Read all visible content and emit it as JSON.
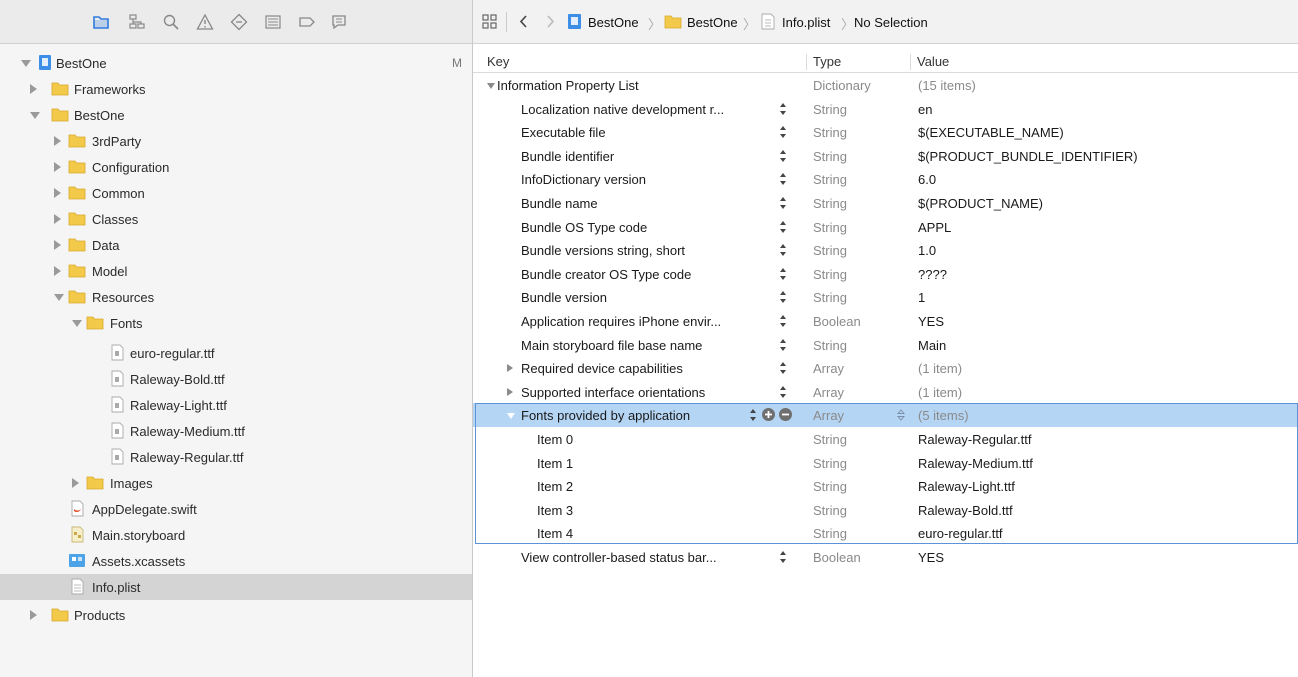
{
  "navigator": {
    "toolbar_icons": [
      "folder-icon",
      "hierarchy-icon",
      "search-icon",
      "warning-icon",
      "test-diamond-icon",
      "debug-icon",
      "breakpoint-icon",
      "report-icon"
    ],
    "badge": "M",
    "tree": [
      {
        "label": "BestOne",
        "icon": "project-icon",
        "state": "open"
      },
      {
        "label": "Frameworks",
        "icon": "folder-icon",
        "state": "closed"
      },
      {
        "label": "BestOne",
        "icon": "folder-icon",
        "state": "open"
      },
      {
        "label": "3rdParty",
        "icon": "folder-icon",
        "state": "closed"
      },
      {
        "label": "Configuration",
        "icon": "folder-icon",
        "state": "closed"
      },
      {
        "label": "Common",
        "icon": "folder-icon",
        "state": "closed"
      },
      {
        "label": "Classes",
        "icon": "folder-icon",
        "state": "closed"
      },
      {
        "label": "Data",
        "icon": "folder-icon",
        "state": "closed"
      },
      {
        "label": "Model",
        "icon": "folder-icon",
        "state": "closed"
      },
      {
        "label": "Resources",
        "icon": "folder-icon",
        "state": "open"
      },
      {
        "label": "Fonts",
        "icon": "folder-icon",
        "state": "open"
      },
      {
        "label": "euro-regular.ttf",
        "icon": "file-icon"
      },
      {
        "label": "Raleway-Bold.ttf",
        "icon": "file-icon"
      },
      {
        "label": "Raleway-Light.ttf",
        "icon": "file-icon"
      },
      {
        "label": "Raleway-Medium.ttf",
        "icon": "file-icon"
      },
      {
        "label": "Raleway-Regular.ttf",
        "icon": "file-icon"
      },
      {
        "label": "Images",
        "icon": "folder-icon",
        "state": "closed"
      },
      {
        "label": "AppDelegate.swift",
        "icon": "swift-file-icon"
      },
      {
        "label": "Main.storyboard",
        "icon": "storyboard-icon"
      },
      {
        "label": "Assets.xcassets",
        "icon": "assets-icon"
      },
      {
        "label": "Info.plist",
        "icon": "plist-file-icon",
        "selected": true
      },
      {
        "label": "Products",
        "icon": "folder-icon",
        "state": "closed"
      }
    ]
  },
  "jumpbar": {
    "crumbs": [
      "BestOne",
      "BestOne",
      "Info.plist",
      "No Selection"
    ]
  },
  "plist": {
    "headers": {
      "key": "Key",
      "type": "Type",
      "value": "Value"
    },
    "rows": [
      {
        "key": "Information Property List",
        "type": "Dictionary",
        "value": "(15 items)",
        "triangle": "open",
        "value_gray": true
      },
      {
        "key": "Localization native development r...",
        "type": "String",
        "value": "en",
        "stepper": true
      },
      {
        "key": "Executable file",
        "type": "String",
        "value": "$(EXECUTABLE_NAME)",
        "stepper": true
      },
      {
        "key": "Bundle identifier",
        "type": "String",
        "value": "$(PRODUCT_BUNDLE_IDENTIFIER)",
        "stepper": true
      },
      {
        "key": "InfoDictionary version",
        "type": "String",
        "value": "6.0",
        "stepper": true
      },
      {
        "key": "Bundle name",
        "type": "String",
        "value": "$(PRODUCT_NAME)",
        "stepper": true
      },
      {
        "key": "Bundle OS Type code",
        "type": "String",
        "value": "APPL",
        "stepper": true
      },
      {
        "key": "Bundle versions string, short",
        "type": "String",
        "value": "1.0",
        "stepper": true
      },
      {
        "key": "Bundle creator OS Type code",
        "type": "String",
        "value": "????",
        "stepper": true
      },
      {
        "key": "Bundle version",
        "type": "String",
        "value": "1",
        "stepper": true
      },
      {
        "key": "Application requires iPhone envir...",
        "type": "Boolean",
        "value": "YES",
        "stepper": true
      },
      {
        "key": "Main storyboard file base name",
        "type": "String",
        "value": "Main",
        "stepper": true
      },
      {
        "key": "Required device capabilities",
        "type": "Array",
        "value": "(1 item)",
        "triangle": "closed",
        "stepper": true,
        "value_gray": true
      },
      {
        "key": "Supported interface orientations",
        "type": "Array",
        "value": "(1 item)",
        "triangle": "closed",
        "stepper": true,
        "value_gray": true
      },
      {
        "key": "Fonts provided by application",
        "type": "Array",
        "value": "(5 items)",
        "triangle": "open",
        "stepper": true,
        "selected": true,
        "value_gray": true
      },
      {
        "key": "Item 0",
        "type": "String",
        "value": "Raleway-Regular.ttf",
        "child": true
      },
      {
        "key": "Item 1",
        "type": "String",
        "value": "Raleway-Medium.ttf",
        "child": true
      },
      {
        "key": "Item 2",
        "type": "String",
        "value": "Raleway-Light.ttf",
        "child": true
      },
      {
        "key": "Item 3",
        "type": "String",
        "value": "Raleway-Bold.ttf",
        "child": true
      },
      {
        "key": "Item 4",
        "type": "String",
        "value": "euro-regular.ttf",
        "child": true
      },
      {
        "key": "View controller-based status bar...",
        "type": "Boolean",
        "value": "YES",
        "stepper": true
      }
    ]
  },
  "colors": {
    "folder": "#f3c94a",
    "selection": "#b5d5f5",
    "selection_border": "#5b95d8",
    "nav_selected": "#d4d4d4"
  }
}
